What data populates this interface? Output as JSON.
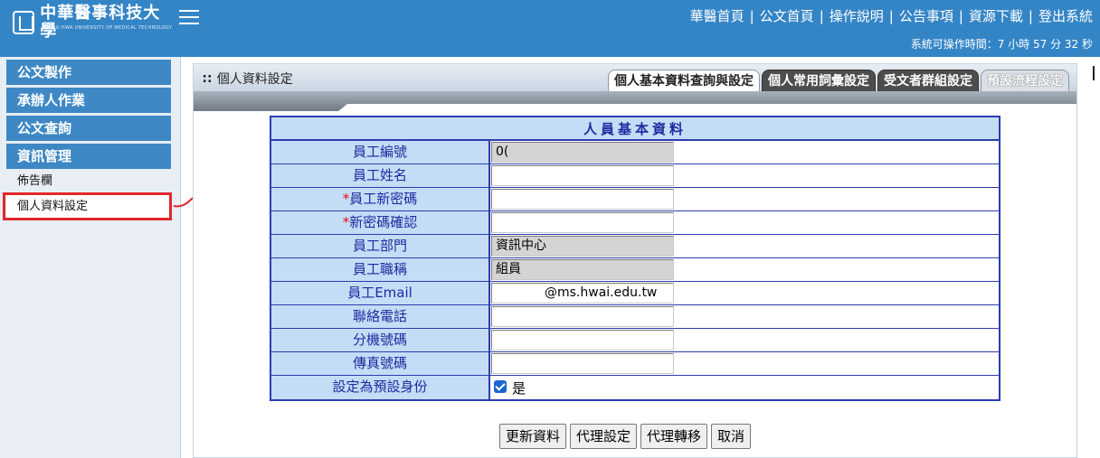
{
  "header": {
    "logo_text": "中華醫事科技大學",
    "logo_sub": "CHUNG HWA UNIVERSITY OF MEDICAL TECHNOLOGY",
    "nav": [
      "華醫首頁",
      "公文首頁",
      "操作說明",
      "公告事項",
      "資源下載",
      "登出系統"
    ],
    "separator": "|",
    "session_text": "系統可操作時間：7 小時 57 分 32 秒"
  },
  "sidebar": {
    "groups": [
      "公文製作",
      "承辦人作業",
      "公文查詢",
      "資訊管理"
    ],
    "subitems": [
      "佈告欄",
      "個人資料設定"
    ]
  },
  "panel": {
    "title_dots": "∷",
    "title": "個人資料設定",
    "tabs": [
      "個人基本資料查詢與設定",
      "個人常用詞彙設定",
      "受文者群組設定",
      "預設流程設定"
    ]
  },
  "form": {
    "header": "人員基本資料",
    "rows": [
      {
        "label": "員工編號",
        "value": "0(",
        "required": false
      },
      {
        "label": "員工姓名",
        "value": "",
        "required": false
      },
      {
        "label": "員工新密碼",
        "value": "",
        "required": true
      },
      {
        "label": "新密碼確認",
        "value": "",
        "required": true
      },
      {
        "label": "員工部門",
        "value": "資訊中心",
        "required": false
      },
      {
        "label": "員工職稱",
        "value": "組員",
        "required": false
      },
      {
        "label": "員工Email",
        "value": "@ms.hwai.edu.tw",
        "required": false
      },
      {
        "label": "聯絡電話",
        "value": "",
        "required": false
      },
      {
        "label": "分機號碼",
        "value": "",
        "required": false
      },
      {
        "label": "傳真號碼",
        "value": "",
        "required": false
      }
    ],
    "default_identity_label": "設定為預設身份",
    "default_identity_value": "是",
    "required_mark": "*"
  },
  "buttons": [
    "更新資料",
    "代理設定",
    "代理轉移",
    "取消"
  ],
  "colors": {
    "header_bg": "#3485c6",
    "label_bg": "#c5dcf6",
    "label_text": "#1c2ba0",
    "highlight": "#e3262e"
  }
}
